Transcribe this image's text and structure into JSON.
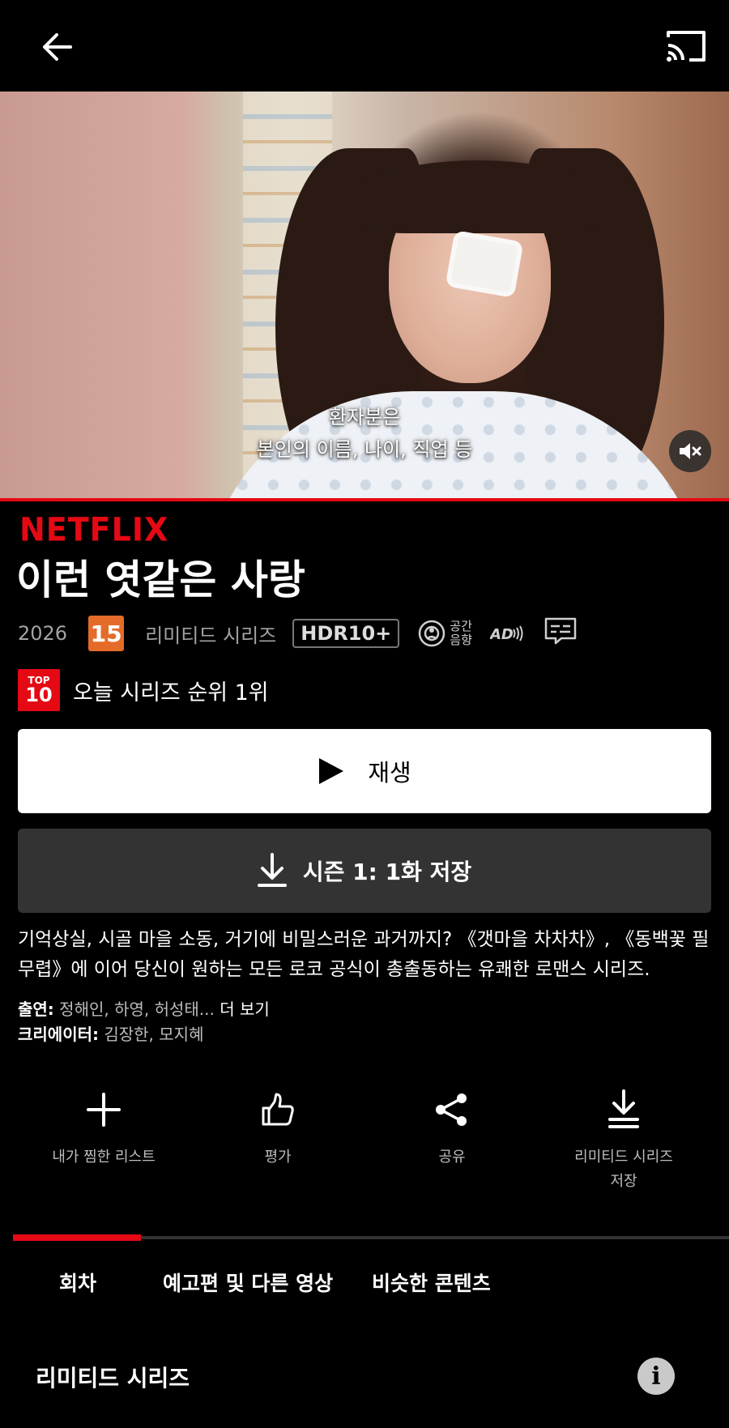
{
  "hero": {
    "subtitle_line1": "환자분은",
    "subtitle_line2": "본인의 이름, 나이, 직업 등",
    "progress": 0.0
  },
  "brand": "NETFLIX",
  "title": "이런 엿같은 사랑",
  "meta": {
    "year": "2026",
    "age_rating": "15",
    "kind": "리미티드 시리즈",
    "hdr": "HDR10+",
    "spatial_audio_line1": "공간",
    "spatial_audio_line2": "음향",
    "ad_label": "AD"
  },
  "ranking": {
    "badge_top": "TOP",
    "badge_num": "10",
    "text": "오늘 시리즈 순위 1위"
  },
  "buttons": {
    "play": "재생",
    "download": "시즌 1: 1화 저장"
  },
  "synopsis": "기억상실, 시골 마을 소동, 거기에 비밀스러운 과거까지? 《갯마을 차차차》, 《동백꽃 필 무렵》에 이어 당신이 원하는 모든 로코 공식이 총출동하는 유쾌한 로맨스 시리즈.",
  "credits": {
    "cast_label": "출연:",
    "cast": " 정해인, 하영, 허성태...",
    "more": "더 보기",
    "creator_label": "크리에이터:",
    "creators": " 김장한, 모지혜"
  },
  "actions": {
    "my_list": "내가 찜한 리스트",
    "rate": "평가",
    "share": "공유",
    "download_series_line1": "리미티드 시리즈",
    "download_series_line2": "저장"
  },
  "tabs": {
    "episodes": "회차",
    "trailers": "예고편 및 다른 영상",
    "similar": "비슷한 콘텐츠"
  },
  "season_label": "리미티드 시리즈",
  "info_glyph": "i",
  "colors": {
    "accent": "#e50914",
    "age_badge": "#e56b2a"
  }
}
